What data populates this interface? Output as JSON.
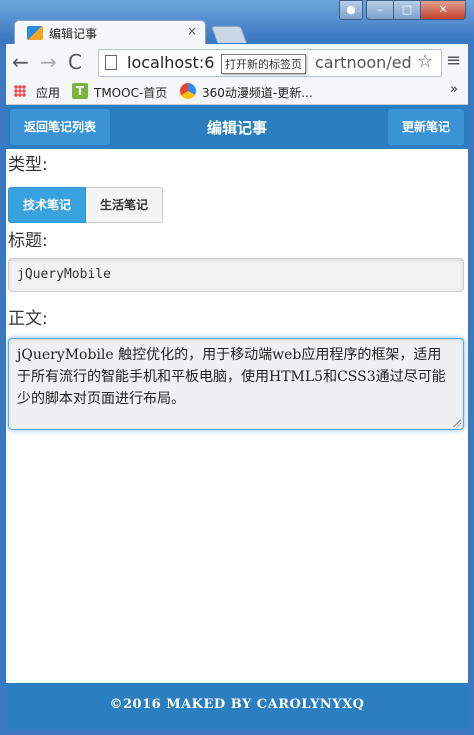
{
  "browser": {
    "tab_title": "编辑记事",
    "tab_close": "×",
    "url_visible": "localhost:6",
    "url_tail": "cartnoon/ed",
    "tooltip": "打开新的标签页",
    "nav_back": "←",
    "nav_forward": "→",
    "nav_reload": "C",
    "star": "☆",
    "menu": "≡",
    "bookmarks": {
      "apps": "应用",
      "tmooc_icon": "T",
      "tmooc": "TMOOC-首页",
      "b360": "360动漫频道-更新...",
      "more": "»"
    },
    "window_buttons": {
      "min": "–",
      "max": "□",
      "close": "✕"
    }
  },
  "header": {
    "back_label": "返回笔记列表",
    "title": "编辑记事",
    "update_label": "更新笔记"
  },
  "form": {
    "type_label": "类型:",
    "type_options": [
      "技术笔记",
      "生活笔记"
    ],
    "type_selected": "技术笔记",
    "title_label": "标题:",
    "title_value": "jQueryMobile",
    "body_label": "正文:",
    "body_value": "jQueryMobile 触控优化的，用于移动端web应用程序的框架，适用于所有流行的智能手机和平板电脑，使用HTML5和CSS3通过尽可能少的脚本对页面进行布局。"
  },
  "footer": {
    "text": "©2016 MAKED BY CAROLYNYXQ"
  },
  "colors": {
    "header_bg": "#2b7fc0",
    "button_bg": "#3b94d6",
    "selected_seg": "#38a2de"
  }
}
